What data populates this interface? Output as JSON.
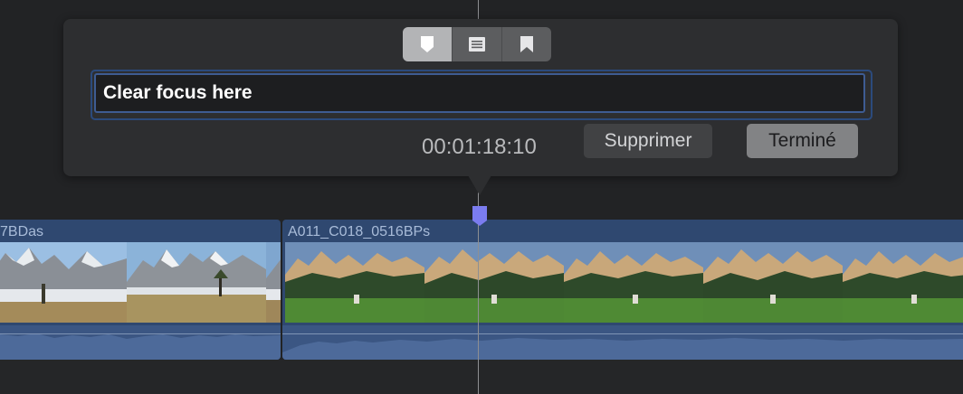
{
  "marker_popover": {
    "tabs": [
      {
        "name": "standard-marker",
        "icon": "marker-icon",
        "active": true
      },
      {
        "name": "todo-marker",
        "icon": "list-icon",
        "active": false
      },
      {
        "name": "chapter-marker",
        "icon": "bookmark-icon",
        "active": false
      }
    ],
    "marker_name_value": "Clear focus here",
    "timecode": "00:01:18:10",
    "delete_label": "Supprimer",
    "done_label": "Terminé"
  },
  "timeline": {
    "clips": [
      {
        "title": "7BDas",
        "scene": "snowy-mountains"
      },
      {
        "title": "A011_C018_0516BPs",
        "scene": "green-valley-mountains"
      }
    ]
  },
  "colors": {
    "background": "#222325",
    "popover": "#2d2e30",
    "clip": "#2f4870",
    "audio": "#3b5683",
    "marker": "#7b7cf0",
    "focus_ring": "#3e5c92"
  }
}
